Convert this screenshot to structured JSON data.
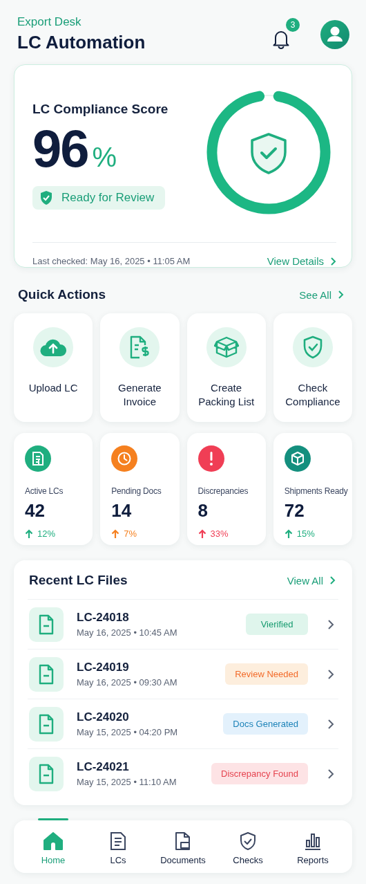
{
  "header": {
    "subtitle": "Export Desk",
    "title": "LC Automation",
    "notification_count": "3"
  },
  "score_card": {
    "title": "LC Compliance Score",
    "value": "96",
    "unit": "%",
    "level": 0.96,
    "status": "Ready for Review",
    "last_checked": "Last checked: May 16, 2025 • 11:05 AM",
    "link": "View Details"
  },
  "quick_actions": {
    "title": "Quick Actions",
    "link": "See All",
    "items": [
      {
        "kind": "upload",
        "label": "Upload LC"
      },
      {
        "kind": "invoice",
        "label": "Generate Invoice"
      },
      {
        "kind": "box",
        "label": "Create Packing List"
      },
      {
        "kind": "shield",
        "label": "Check Compliance"
      }
    ]
  },
  "stats": [
    {
      "kind": "doc",
      "color": "#1fae7f",
      "label": "Active LCs",
      "value": "42",
      "trend": {
        "text": "12%",
        "color": "#1fae7f"
      }
    },
    {
      "kind": "clock",
      "color": "#f5801f",
      "label": "Pending Docs",
      "value": "14",
      "trend": {
        "text": "7%",
        "color": "#f5801f"
      }
    },
    {
      "kind": "alert",
      "color": "#f03e55",
      "label": "Discrepancies",
      "value": "8",
      "trend": {
        "text": "33%",
        "color": "#f03e55"
      }
    },
    {
      "kind": "box",
      "color": "#148f7e",
      "label": "Shipments Ready",
      "value": "72",
      "trend": {
        "text": "15%",
        "color": "#1fae7f"
      }
    }
  ],
  "recent_files": {
    "title": "Recent LC Files",
    "link": "View All",
    "rows": [
      {
        "id": "LC-24018",
        "date": "May 16, 2025 • 10:45 AM",
        "status": "Vierified",
        "kind": "success"
      },
      {
        "id": "LC-24019",
        "date": "May 16, 2025 • 09:30 AM",
        "status": "Review Needed",
        "kind": "warning"
      },
      {
        "id": "LC-24020",
        "date": "May 15, 2025 • 04:20 PM",
        "status": "Docs Generated",
        "kind": "info"
      },
      {
        "id": "LC-24021",
        "date": "May 15, 2025 • 11:10 AM",
        "status": "Discrepancy Found",
        "kind": "danger"
      }
    ]
  },
  "nav": [
    {
      "kind": "home",
      "label": "Home",
      "selected": true
    },
    {
      "kind": "list",
      "label": "LCs",
      "selected": false
    },
    {
      "kind": "folder",
      "label": "Documents",
      "selected": false
    },
    {
      "kind": "shield",
      "label": "Checks",
      "selected": false
    },
    {
      "kind": "chart",
      "label": "Reports",
      "selected": false
    }
  ]
}
